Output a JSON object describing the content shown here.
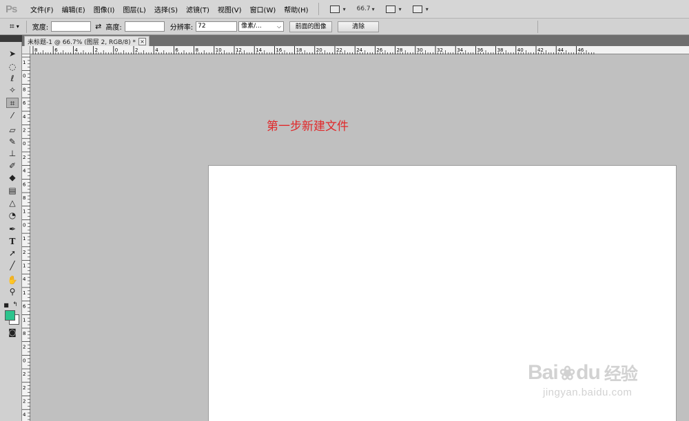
{
  "menubar": {
    "logo": "Ps",
    "items": [
      "文件(F)",
      "编辑(E)",
      "图像(I)",
      "图层(L)",
      "选择(S)",
      "滤镜(T)",
      "视图(V)",
      "窗口(W)",
      "帮助(H)"
    ],
    "zoom_value": "66.7"
  },
  "options": {
    "width_label": "宽度:",
    "width_value": "",
    "height_label": "高度:",
    "height_value": "",
    "resolution_label": "分辨率:",
    "resolution_value": "72",
    "unit_value": "像素/...",
    "front_image_button": "前面的图像",
    "clear_button": "清除"
  },
  "document": {
    "tab_title": "未标题-1 @ 66.7% (图层 2, RGB/8) *",
    "close_glyph": "×"
  },
  "ruler": {
    "h_labels": [
      "8",
      "6",
      "4",
      "2",
      "0",
      "2",
      "4",
      "6",
      "8",
      "10",
      "12",
      "14",
      "16",
      "18",
      "20",
      "22",
      "24",
      "26",
      "28",
      "30",
      "32",
      "34",
      "36",
      "38",
      "40",
      "42",
      "44",
      "46"
    ],
    "v_labels": [
      "1",
      "0",
      "8",
      "6",
      "4",
      "2",
      "0",
      "2",
      "4",
      "6",
      "8",
      "1",
      "0",
      "1",
      "2",
      "1",
      "4",
      "1",
      "6",
      "1",
      "8",
      "2",
      "0",
      "2",
      "2",
      "2",
      "4"
    ]
  },
  "canvas": {
    "annotation": "第一步新建文件"
  },
  "watermark": {
    "brand_left": "Bai",
    "brand_right": "du",
    "brand_cn": "经验",
    "url": "jingyan.baidu.com"
  },
  "colors": {
    "foreground_swatch": "#2dc48d",
    "background_swatch": "#ffffff",
    "annotation_text": "#e0282a"
  },
  "tools": [
    "move-icon",
    "marquee-icon",
    "lasso-icon",
    "quick-select-icon",
    "crop-icon",
    "eyedropper-icon",
    "healing-brush-icon",
    "brush-icon",
    "clone-stamp-icon",
    "history-brush-icon",
    "eraser-icon",
    "gradient-icon",
    "blur-icon",
    "dodge-icon",
    "pen-icon",
    "type-icon",
    "path-select-icon",
    "line-icon",
    "hand-icon",
    "zoom-icon",
    "quick-mask-icon"
  ]
}
